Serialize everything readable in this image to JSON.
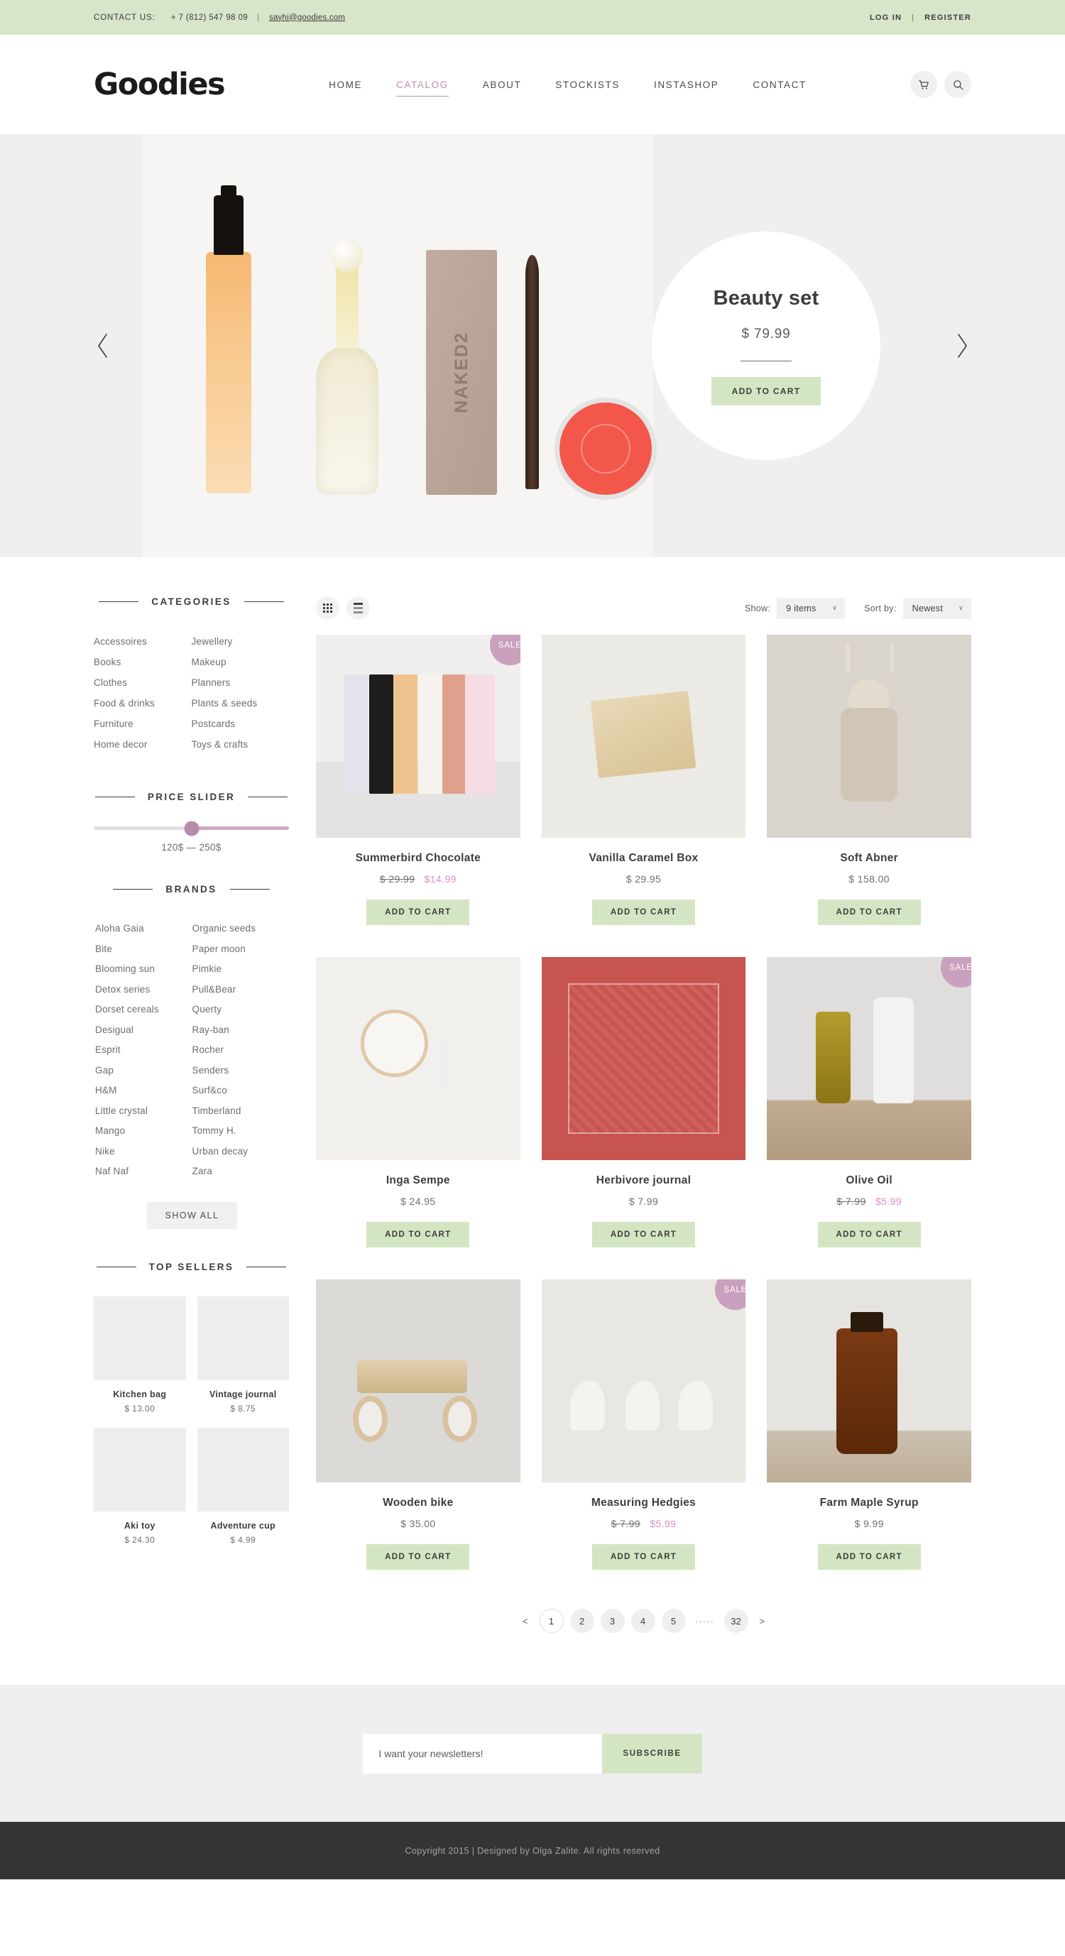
{
  "topbar": {
    "contact_label": "CONTACT US:",
    "phone": "+ 7 (812) 547 98 09",
    "email": "sayhi@goodies.com",
    "login": "LOG IN",
    "register": "REGISTER",
    "separator": "|"
  },
  "header": {
    "logo": "Goodies",
    "nav": [
      {
        "label": "HOME",
        "active": false
      },
      {
        "label": "CATALOG",
        "active": true
      },
      {
        "label": "ABOUT",
        "active": false
      },
      {
        "label": "STOCKISTS",
        "active": false
      },
      {
        "label": "INSTASHOP",
        "active": false
      },
      {
        "label": "CONTACT",
        "active": false
      }
    ],
    "cart_icon": "cart-icon",
    "search_icon": "search-icon"
  },
  "hero": {
    "title": "Beauty set",
    "price": "$ 79.99",
    "cta": "ADD TO CART",
    "prev_icon": "chevron-left-icon",
    "next_icon": "chevron-right-icon"
  },
  "sidebar": {
    "categories_title": "CATEGORIES",
    "categories_left": [
      "Accessoires",
      "Books",
      "Clothes",
      "Food & drinks",
      "Furniture",
      "Home decor"
    ],
    "categories_right": [
      "Jewellery",
      "Makeup",
      "Planners",
      "Plants & seeds",
      "Postcards",
      "Toys & crafts"
    ],
    "price_title": "PRICE SLIDER",
    "price_value": "120$ — 250$",
    "brands_title": "BRANDS",
    "brands_left": [
      "Aloha Gaia",
      "Bite",
      "Blooming sun",
      "Detox series",
      "Dorset  cereals",
      "Desigual",
      "Esprit",
      "Gap",
      "H&M",
      "Little crystal",
      "Mango",
      "Nike",
      "Naf Naf"
    ],
    "brands_right": [
      "Organic seeds",
      "Paper moon",
      "Pimkie",
      "Pull&Bear",
      "Querty",
      "Ray-ban",
      "Rocher",
      "Senders",
      "Surf&co",
      "Timberland",
      "Tommy H.",
      "Urban decay",
      "Zara"
    ],
    "show_all": "SHOW ALL",
    "top_sellers_title": "TOP SELLERS",
    "top_sellers": [
      {
        "name": "Kitchen bag",
        "price": "$ 13.00",
        "art": "th-bag"
      },
      {
        "name": "Vintage journal",
        "price": "$ 8.75",
        "art": "th-journal"
      },
      {
        "name": "Aki toy",
        "price": "$ 24.30",
        "art": "th-toy"
      },
      {
        "name": "Adventure cup",
        "price": "$ 4.99",
        "art": "th-cup"
      }
    ]
  },
  "toolbar": {
    "grid_icon": "grid-view-icon",
    "list_icon": "list-view-icon",
    "show_label": "Show:",
    "show_value": "9 items",
    "sort_label": "Sort by:",
    "sort_value": "Newest",
    "chevron": "∨"
  },
  "products": [
    {
      "name": "Summerbird Chocolate",
      "price": "",
      "old_price": "$ 29.99",
      "new_price": "$14.99",
      "sale": true,
      "badge": "SALE",
      "cta": "ADD TO CART",
      "art": "a-choc"
    },
    {
      "name": "Vanilla Caramel Box",
      "price": "$ 29.95",
      "old_price": "",
      "new_price": "",
      "sale": false,
      "badge": "",
      "cta": "ADD TO CART",
      "art": "a-vanilla"
    },
    {
      "name": "Soft Abner",
      "price": "$ 158.00",
      "old_price": "",
      "new_price": "",
      "sale": false,
      "badge": "",
      "cta": "ADD TO CART",
      "art": "a-abner"
    },
    {
      "name": "Inga Sempe",
      "price": "$ 24.95",
      "old_price": "",
      "new_price": "",
      "sale": false,
      "badge": "",
      "cta": "ADD TO CART",
      "art": "a-mirror"
    },
    {
      "name": "Herbivore journal",
      "price": "$ 7.99",
      "old_price": "",
      "new_price": "",
      "sale": false,
      "badge": "",
      "cta": "ADD TO CART",
      "art": "a-herb"
    },
    {
      "name": "Olive Oil",
      "price": "",
      "old_price": "$ 7.99",
      "new_price": "$5.99",
      "sale": true,
      "badge": "SALE",
      "cta": "ADD TO CART",
      "art": "a-olive"
    },
    {
      "name": "Wooden bike",
      "price": "$ 35.00",
      "old_price": "",
      "new_price": "",
      "sale": false,
      "badge": "",
      "cta": "ADD TO CART",
      "art": "a-bike"
    },
    {
      "name": "Measuring Hedgies",
      "price": "",
      "old_price": "$ 7.99",
      "new_price": "$5.99",
      "sale": true,
      "badge": "SALE",
      "cta": "ADD TO CART",
      "art": "a-hedge"
    },
    {
      "name": "Farm Maple Syrup",
      "price": "$ 9.99",
      "old_price": "",
      "new_price": "",
      "sale": false,
      "badge": "",
      "cta": "ADD TO CART",
      "art": "a-syrup"
    }
  ],
  "pagination": {
    "prev": "<",
    "next": ">",
    "pages": [
      "1",
      "2",
      "3",
      "4",
      "5"
    ],
    "dots": "·····",
    "last": "32",
    "active": "1"
  },
  "newsletter": {
    "placeholder": "I want your newsletters!",
    "value": "",
    "button": "SUBSCRIBE"
  },
  "footer": {
    "copyright": "Copyright 2015 | Designed by Olga Zalite. All rights reserved"
  },
  "colors": {
    "green": "#d4e5c3",
    "top_green": "#d7e5c9",
    "pink": "#c9a0bd",
    "sale_price": "#d98fc0",
    "footer": "#343434"
  }
}
